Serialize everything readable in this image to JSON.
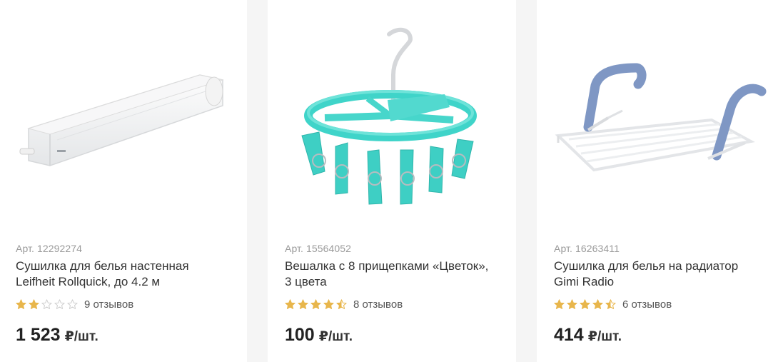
{
  "products": [
    {
      "art": "Арт. 12292274",
      "title_line1": "Сушилка для белья настенная",
      "title_line2": "Leifheit Rollquick, до 4.2 м",
      "rating": 2,
      "reviews": "9 отзывов",
      "price": "1 523",
      "unit": "₽/шт."
    },
    {
      "art": "Арт. 15564052",
      "title_line1": "Вешалка с 8 прищепками «Цветок»,",
      "title_line2": "3 цвета",
      "rating": 4.5,
      "reviews": "8 отзывов",
      "price": "100",
      "unit": "₽/шт."
    },
    {
      "art": "Арт. 16263411",
      "title_line1": "Сушилка для белья на радиатор",
      "title_line2": "Gimi Radio",
      "rating": 4.5,
      "reviews": "6 отзывов",
      "price": "414",
      "unit": "₽/шт."
    }
  ],
  "colors": {
    "star_filled": "#e8b64c",
    "star_empty": "#cfcfcf",
    "page_background": "#f5f5f5",
    "card_background": "#ffffff"
  }
}
